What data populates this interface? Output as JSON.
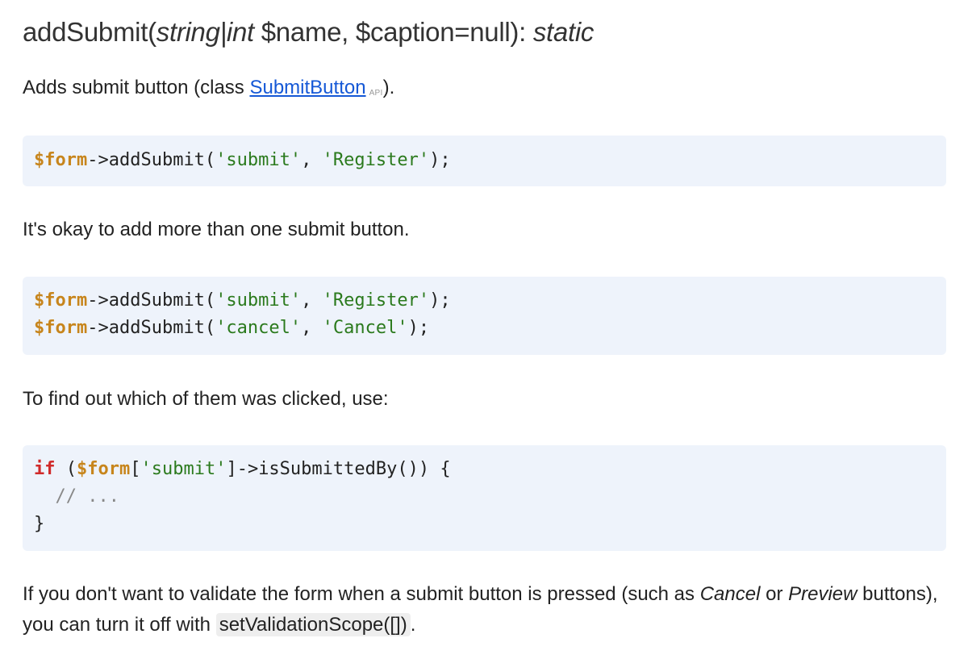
{
  "heading": {
    "name": "addSubmit(",
    "param_type": "string|int",
    "params": " $name, $caption=null): ",
    "return_type": "static"
  },
  "para1": {
    "before": "Adds submit button (class ",
    "link": "SubmitButton",
    "badge": "API",
    "after": ")."
  },
  "code1": {
    "line1": {
      "var": "$form",
      "call": "->addSubmit(",
      "arg1": "'submit'",
      "sep": ", ",
      "arg2": "'Register'",
      "end": ");"
    }
  },
  "para2": "It's okay to add more than one submit button.",
  "code2": {
    "line1": {
      "var": "$form",
      "call": "->addSubmit(",
      "arg1": "'submit'",
      "sep": ", ",
      "arg2": "'Register'",
      "end": ");"
    },
    "line2": {
      "var": "$form",
      "call": "->addSubmit(",
      "arg1": "'cancel'",
      "sep": ", ",
      "arg2": "'Cancel'",
      "end": ");"
    }
  },
  "para3": "To find out which of them was clicked, use:",
  "code3": {
    "kw": "if",
    "open": " (",
    "var": "$form",
    "bracket_open": "[",
    "key": "'submit'",
    "rest": "]->isSubmittedBy()) {",
    "comment": "  // ...",
    "close": "}"
  },
  "para4": {
    "t1": "If you don't want to validate the form when a submit button is pressed (such as ",
    "em1": "Cancel",
    "t2": " or ",
    "em2": "Preview",
    "t3": " buttons), you can turn it off with ",
    "code": "setValidationScope([])",
    "t4": "."
  },
  "colors": {
    "code_background": "#eef3fb",
    "variable": "#c7851c",
    "string": "#2b7a1d",
    "keyword": "#d02a2a",
    "link": "#1558d6"
  }
}
